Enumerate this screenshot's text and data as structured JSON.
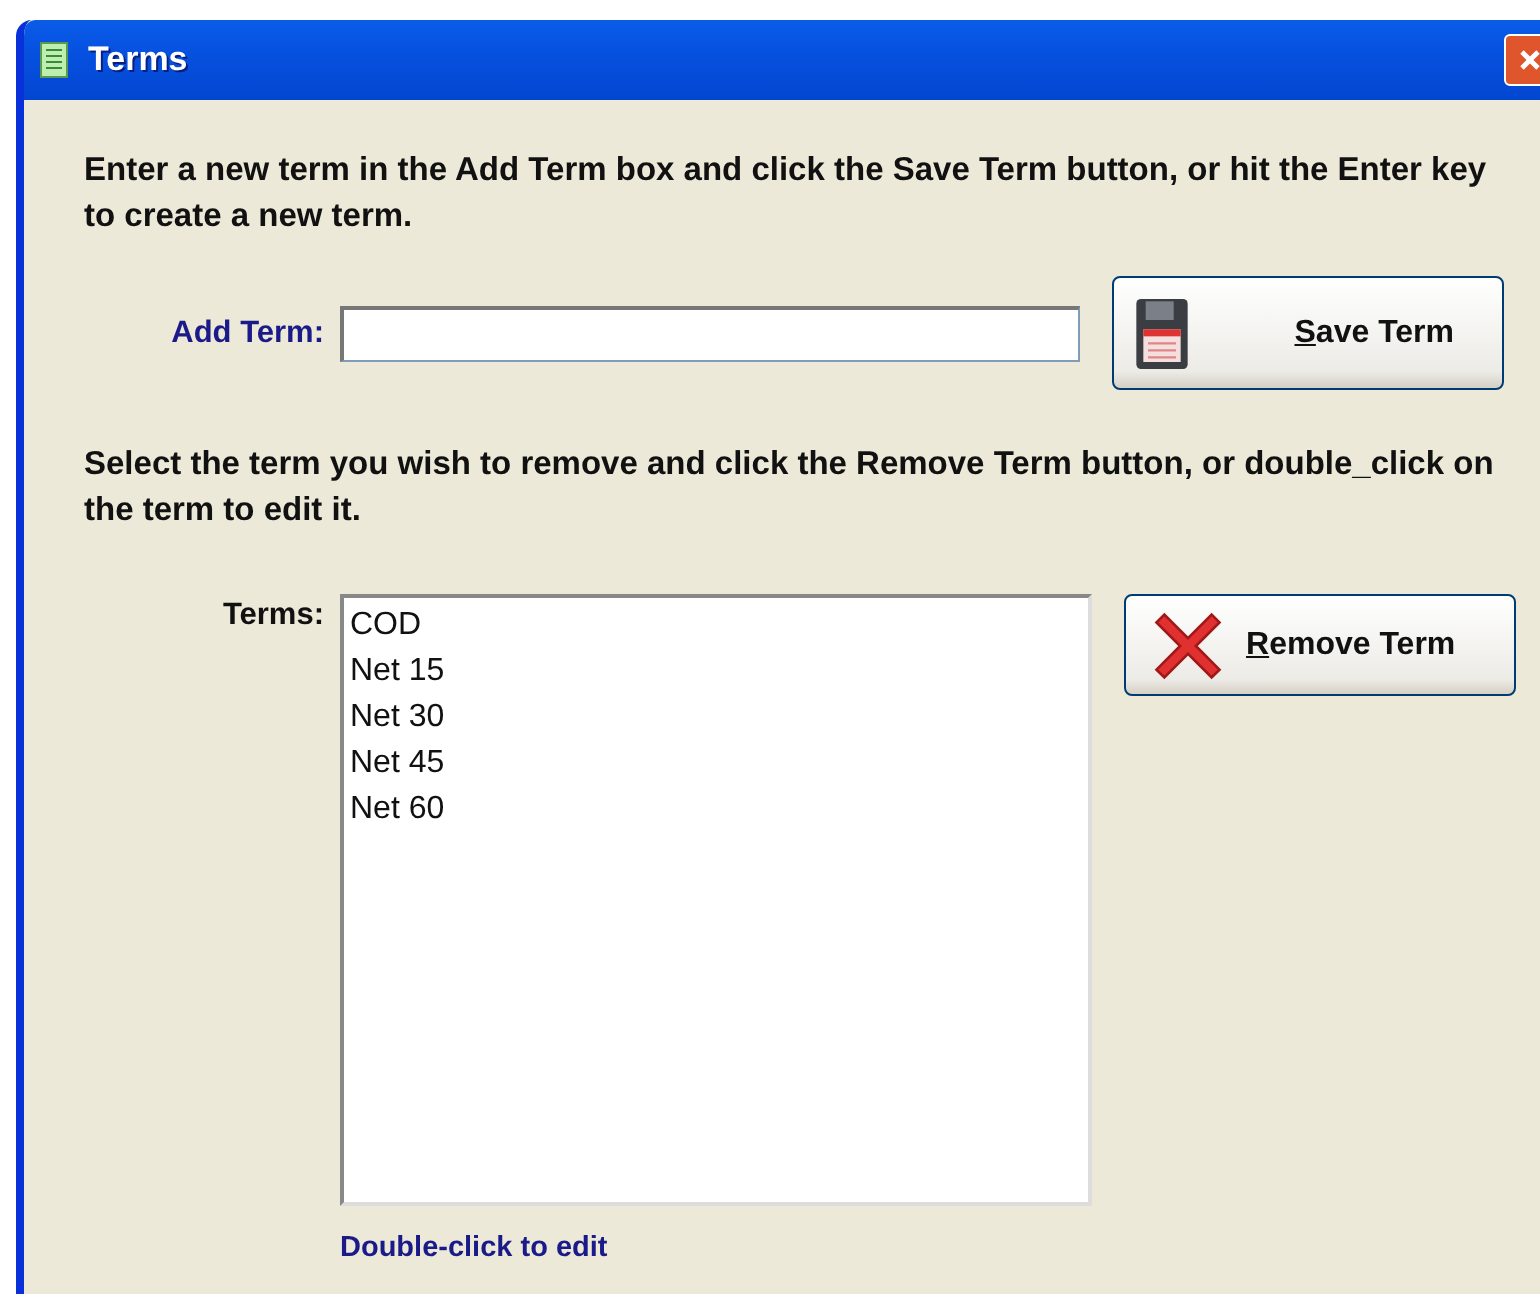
{
  "window": {
    "title": "Terms"
  },
  "instructions_add": "Enter a new term in the Add Term box and click the Save Term button, or hit the Enter key to create a new term.",
  "add_term": {
    "label": "Add Term:"
  },
  "save_button": {
    "mnemonic": "S",
    "rest": "ave Term"
  },
  "instructions_remove": "Select the term you wish to remove and click the Remove Term button, or double_click on the term to edit it.",
  "terms": {
    "label": "Terms:",
    "items": [
      {
        "text": "COD",
        "selected": false
      },
      {
        "text": "Net 15",
        "selected": false
      },
      {
        "text": "Net 30",
        "selected": false
      },
      {
        "text": "Net 45",
        "selected": false
      },
      {
        "text": "Net 60",
        "selected": false
      }
    ]
  },
  "remove_button": {
    "mnemonic": "R",
    "rest": "emove Term"
  },
  "hint": "Double-click to edit"
}
